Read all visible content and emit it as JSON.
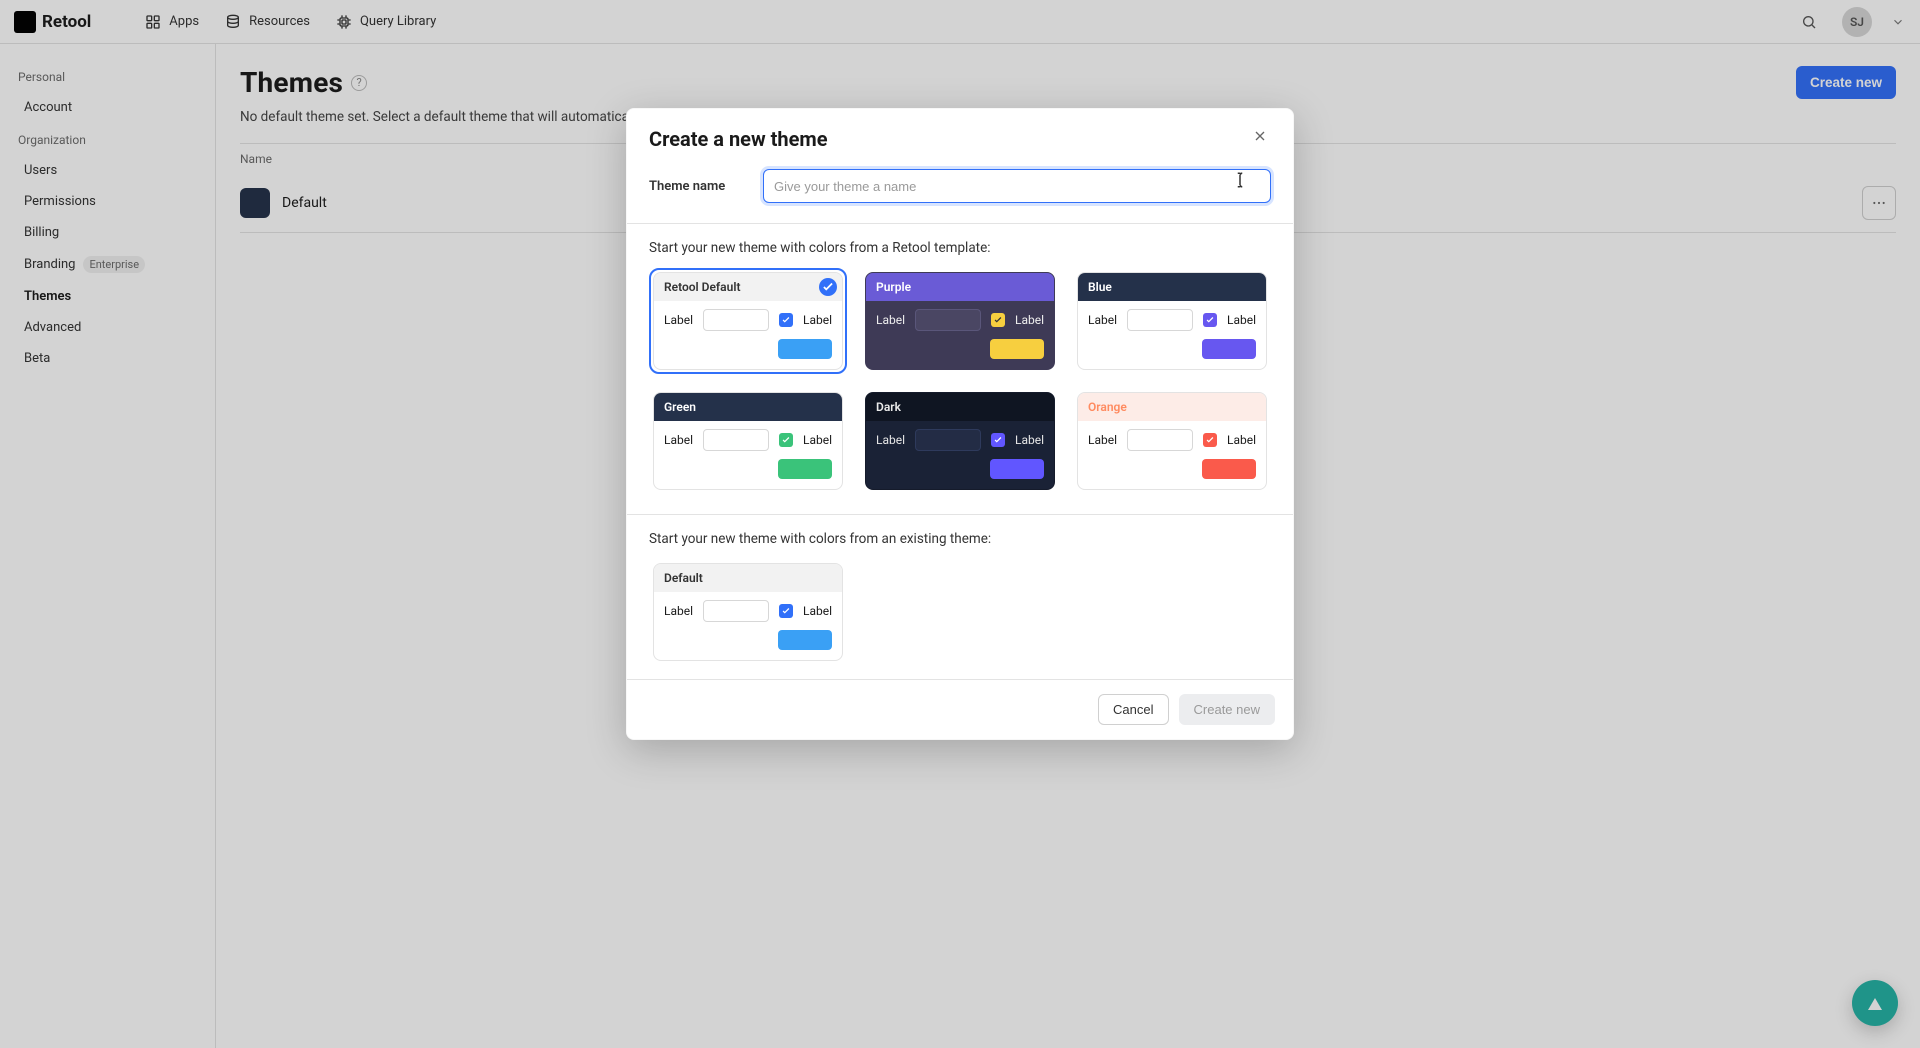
{
  "brand": {
    "name": "Retool"
  },
  "nav": {
    "apps": "Apps",
    "resources": "Resources",
    "query_library": "Query Library"
  },
  "user": {
    "initials": "SJ"
  },
  "sidebar": {
    "sections": {
      "personal": {
        "title": "Personal",
        "items": [
          {
            "label": "Account"
          }
        ]
      },
      "organization": {
        "title": "Organization",
        "items": [
          {
            "label": "Users"
          },
          {
            "label": "Permissions"
          },
          {
            "label": "Billing"
          },
          {
            "label": "Branding",
            "badge": "Enterprise"
          },
          {
            "label": "Themes",
            "active": true
          },
          {
            "label": "Advanced"
          },
          {
            "label": "Beta"
          }
        ]
      }
    }
  },
  "page": {
    "title": "Themes",
    "description": "No default theme set. Select a default theme that will automatically be applied to any apps without a theme set.",
    "create": "Create new",
    "list": {
      "header": "Name",
      "rows": [
        {
          "name": "Default"
        }
      ]
    }
  },
  "modal": {
    "title": "Create a new theme",
    "theme_name_label": "Theme name",
    "theme_name_placeholder": "Give your theme a name",
    "section_templates_title": "Start your new theme with colors from a Retool template:",
    "section_existing_title": "Start your new theme with colors from an existing theme:",
    "cancel": "Cancel",
    "create": "Create new",
    "card_label": "Label",
    "templates": [
      {
        "key": "retool_default",
        "name": "Retool Default"
      },
      {
        "key": "purple",
        "name": "Purple"
      },
      {
        "key": "blue",
        "name": "Blue"
      },
      {
        "key": "green",
        "name": "Green"
      },
      {
        "key": "dark",
        "name": "Dark"
      },
      {
        "key": "orange",
        "name": "Orange"
      }
    ],
    "existing": [
      {
        "key": "default",
        "name": "Default"
      }
    ],
    "selected_template": "retool_default"
  },
  "colors": {
    "primary": "#3170f9",
    "navy": "#24314a",
    "purple": "#6a5bd6",
    "yellow": "#f7cf3f",
    "bluebtn": "#6757f0",
    "green": "#3ac37a",
    "dark": "#0f1522",
    "indigo": "#6156ff",
    "orange_bg": "#fdece7",
    "orange": "#ff8b60",
    "red": "#fa5a4b",
    "fab_green": "#24b3a5"
  }
}
